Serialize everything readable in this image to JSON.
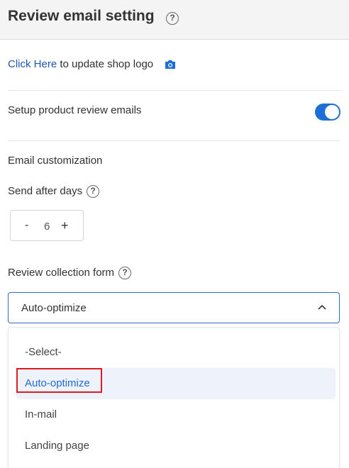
{
  "header": {
    "title": "Review email setting",
    "help_icon": "question-circle-icon"
  },
  "logo_row": {
    "link_text": "Click Here",
    "text": " to update shop logo",
    "icon": "camera-icon"
  },
  "setup": {
    "label": "Setup product review emails",
    "toggle_on": true
  },
  "email_customization": {
    "title": "Email customization"
  },
  "send_after": {
    "label": "Send after days",
    "minus": "-",
    "value": "6",
    "plus": "+"
  },
  "review_form": {
    "label": "Review collection form",
    "selected": "Auto-optimize",
    "options": [
      "-Select-",
      "Auto-optimize",
      "In-mail",
      "Landing page"
    ]
  },
  "colors": {
    "accent": "#1c6fd6",
    "link": "#1f55b4",
    "highlight": "#e01b24"
  }
}
